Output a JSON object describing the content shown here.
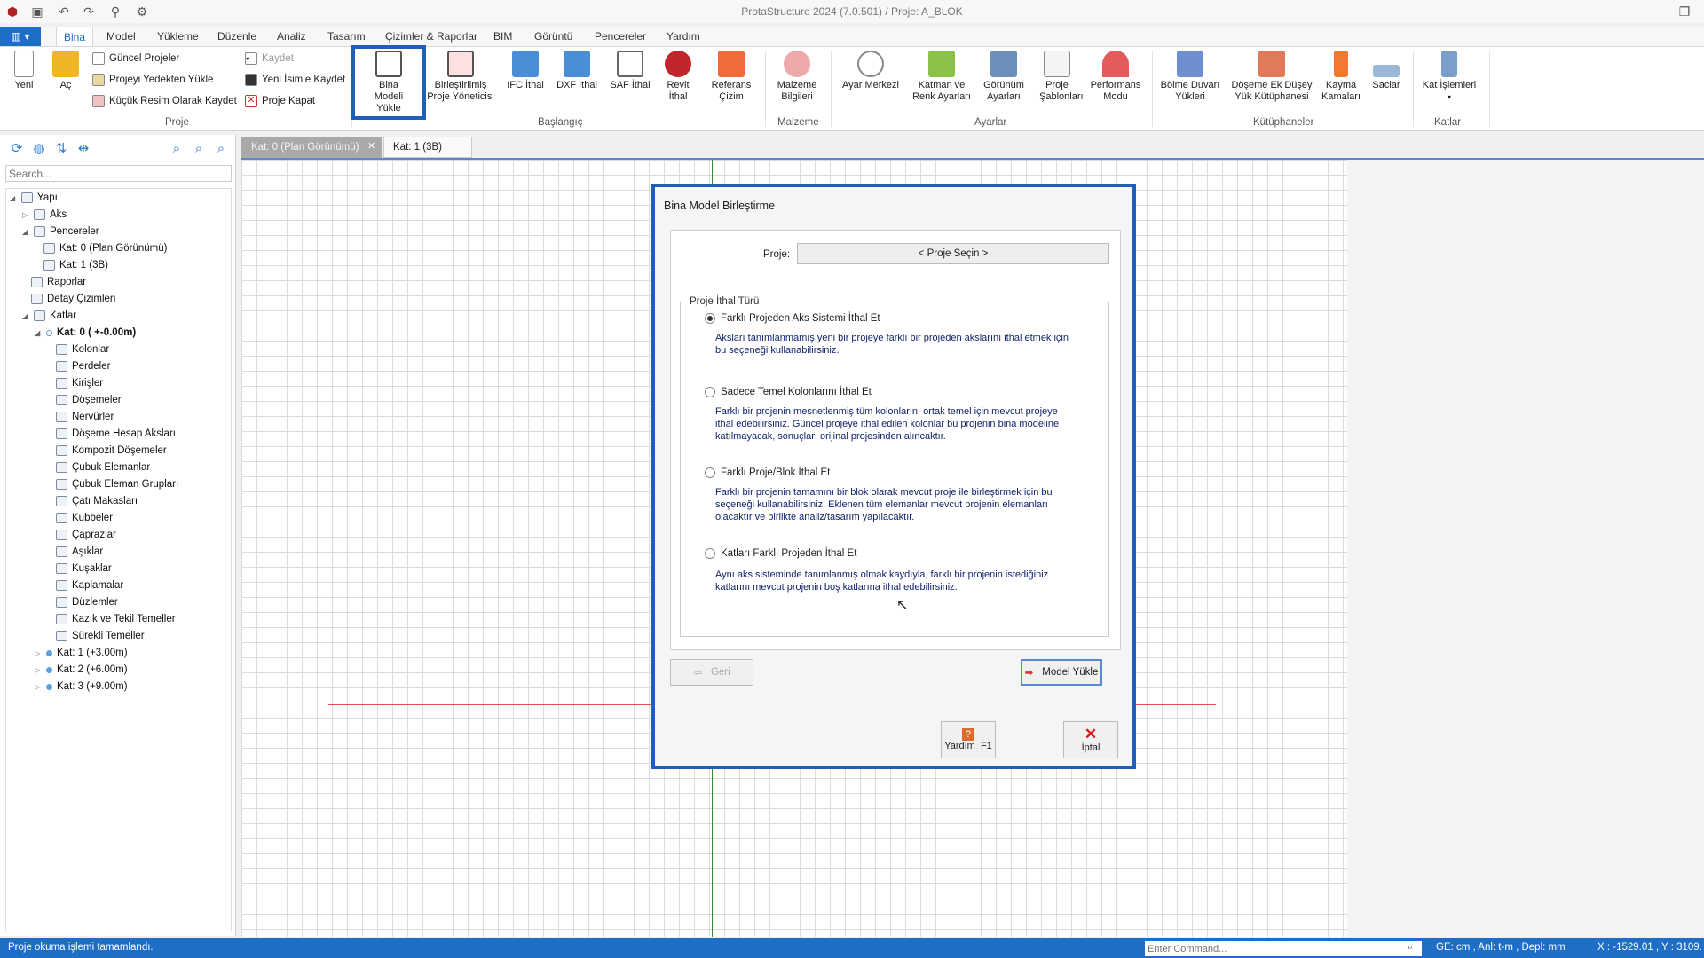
{
  "app_title": "ProtaStructure 2024 (7.0.501) / Proje: A_BLOK",
  "menu": [
    "Bina",
    "Model",
    "Yükleme",
    "Düzenle",
    "Analiz",
    "Tasarım",
    "Çizimler & Raporlar",
    "BIM",
    "Görüntü",
    "Pencereler",
    "Yardım"
  ],
  "ribbon": {
    "new": "Yeni",
    "open": "Aç",
    "current_projects": "Güncel Projeler",
    "load_backup": "Projeyi Yedekten Yükle",
    "save_thumb": "Küçük Resim Olarak Kaydet",
    "save": "Kaydet",
    "save_as": "Yeni İsimle Kaydet",
    "close_project": "Proje Kapat",
    "group_project": "Proje",
    "load_building": "Bina Modeli Yükle",
    "merged_manager": "Birleştirilmiş Proje Yöneticisi",
    "ifc": "IFC İthal",
    "dxf": "DXF İthal",
    "saf": "SAF İthal",
    "revit": "Revit İthal",
    "ref_drawing": "Referans Çizim",
    "group_start": "Başlangıç",
    "material_info": "Malzeme Bilgileri",
    "group_material": "Malzeme",
    "settings_center": "Ayar Merkezi",
    "layer_color": "Katman ve Renk Ayarları",
    "view_settings": "Görünüm Ayarları",
    "project_templates": "Proje Şablonları",
    "performance": "Performans Modu",
    "group_settings": "Ayarlar",
    "partition_loads": "Bölme Duvarı Yükleri",
    "slab_vertical": "Döşeme Ek Düşey Yük Kütüphanesi",
    "shear_keys": "Kayma Kamaları",
    "sheets": "Saclar",
    "group_libraries": "Kütüphaneler",
    "floor_ops": "Kat İşlemleri",
    "group_floors": "Katlar"
  },
  "search_placeholder": "Search...",
  "tree": {
    "root": "Yapı",
    "aks": "Aks",
    "windows": "Pencereler",
    "win0": "Kat: 0 (Plan Görünümü)",
    "win1": "Kat: 1 (3B)",
    "reports": "Raporlar",
    "details": "Detay Çizimleri",
    "floors": "Katlar",
    "floor0": "Kat: 0 ( +-0.00m)",
    "items": [
      "Kolonlar",
      "Perdeler",
      "Kirişler",
      "Döşemeler",
      "Nervürler",
      "Döşeme Hesap Aksları",
      "Kompozit Döşemeler",
      "Çubuk Elemanlar",
      "Çubuk Eleman Grupları",
      "Çatı Makasları",
      "Kubbeler",
      "Çaprazlar",
      "Aşıklar",
      "Kuşaklar",
      "Kaplamalar",
      "Düzlemler",
      "Kazık ve Tekil Temeller",
      "Sürekli Temeller"
    ],
    "floor1": "Kat: 1 (+3.00m)",
    "floor2": "Kat: 2 (+6.00m)",
    "floor3": "Kat: 3 (+9.00m)"
  },
  "tabs": [
    "Kat: 0 (Plan Görünümü)",
    "Kat: 1 (3B)"
  ],
  "dialog": {
    "title": "Bina Model Birleştirme",
    "project_label": "Proje:",
    "project_button": "< Proje Seçin >",
    "group_label": "Proje İthal Türü",
    "options": [
      {
        "label": "Farklı Projeden Aks Sistemi İthal Et",
        "desc": "Aksları tanımlanmamış yeni bir projeye farklı bir projeden akslarını ithal etmek için bu seçeneği kullanabilirsiniz.",
        "selected": true
      },
      {
        "label": "Sadece Temel Kolonlarını İthal Et",
        "desc": "Farklı bir projenin mesnetlenmiş tüm kolonlarını ortak temel için mevcut projeye ithal edebilirsiniz. Güncel projeye ithal edilen kolonlar bu projenin bina modeline katılmayacak, sonuçları orijinal projesinden alıncaktır.",
        "selected": false
      },
      {
        "label": "Farklı Proje/Blok İthal Et",
        "desc": "Farklı bir projenin tamamını bir blok olarak mevcut proje ile birleştirmek için bu seçeneği kullanabilirsiniz. Eklenen tüm elemanlar mevcut projenin elemanları olacaktır ve birlikte analiz/tasarım yapılacaktır.",
        "selected": false
      },
      {
        "label": "Katları Farklı Projeden İthal Et",
        "desc": "Aynı aks sisteminde tanımlanmış olmak kaydıyla, farklı bir projenin istediğiniz katlarını mevcut projenin boş katlarına ithal edebilirsiniz.",
        "selected": false
      }
    ],
    "back": "Geri",
    "load_model": "Model Yükle",
    "help": "Yardım",
    "help_key": "F1",
    "cancel": "İptal"
  },
  "status": {
    "message": "Proje okuma işlemi tamamlandı.",
    "command_placeholder": "Enter Command...",
    "units": "GE: cm , Anl: t-m , Depl: mm",
    "coords": "X : -1529.01 , Y : 3109."
  },
  "colors": {
    "accent": "#1e6ec8",
    "highlight": "#1f5fb8",
    "dialog_text": "#12246e"
  }
}
